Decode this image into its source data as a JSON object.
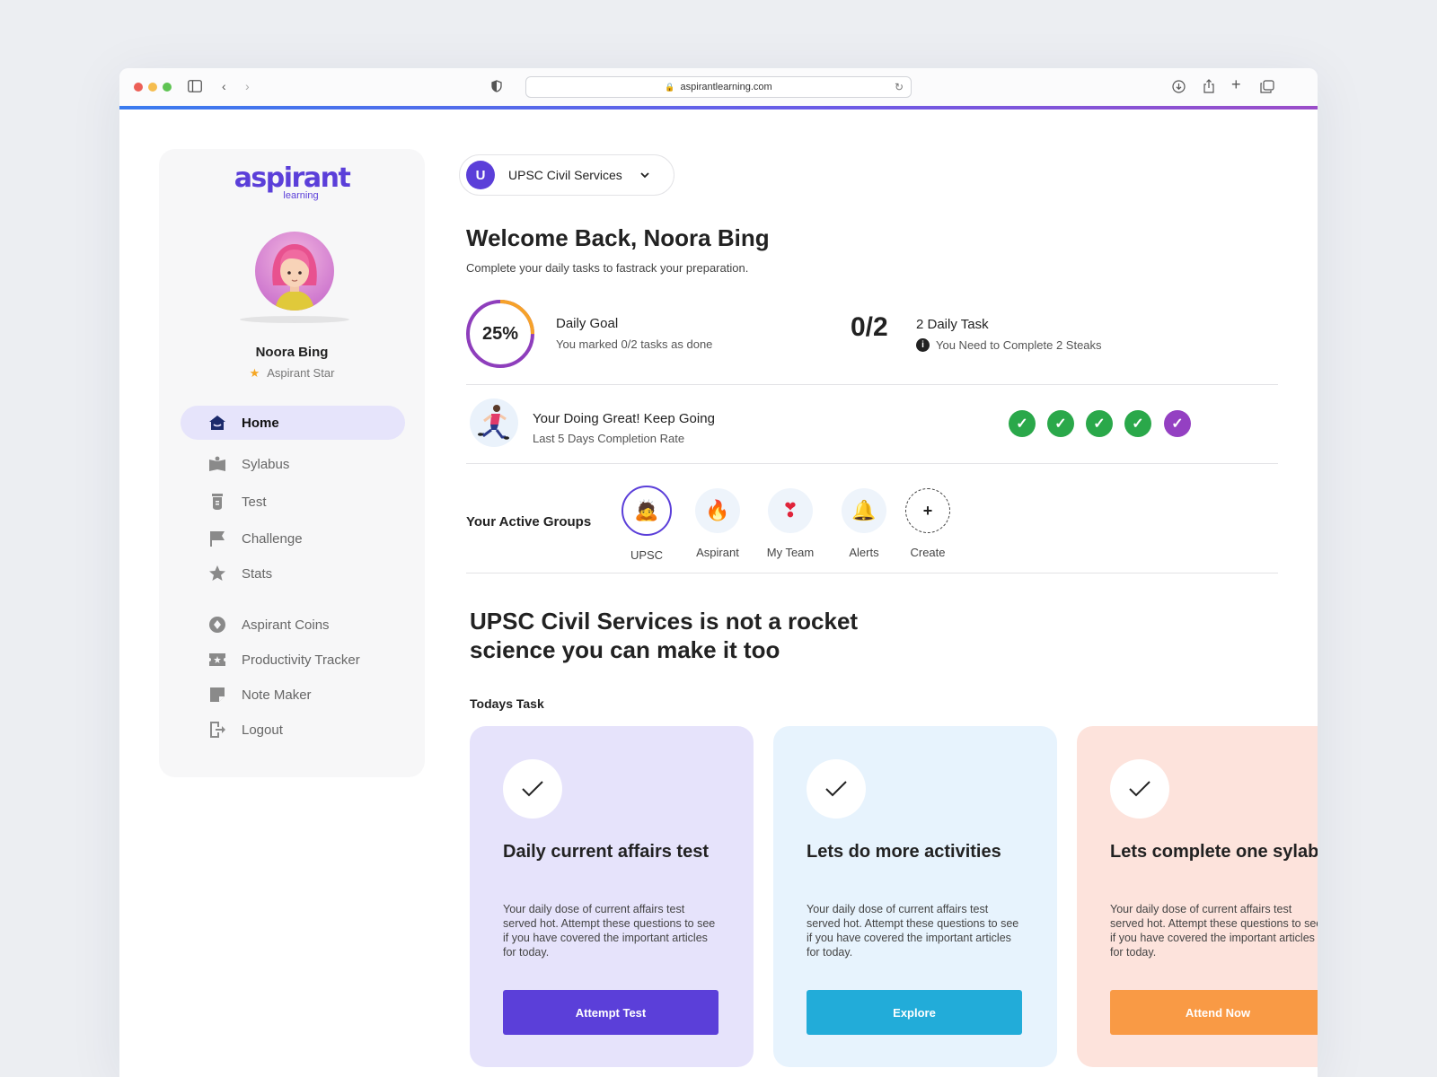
{
  "browser": {
    "url": "aspirantlearning.com",
    "traffic_lights": [
      "#ec5f56",
      "#f5bd4f",
      "#5fc453"
    ]
  },
  "brand": {
    "name": "aspirant",
    "sub": "learning",
    "color": "#5b3fd9"
  },
  "user": {
    "name": "Noora Bing",
    "role": "Aspirant Star"
  },
  "sidebar": {
    "items": [
      {
        "label": "Home",
        "icon": "home-icon",
        "active": true
      },
      {
        "label": "Sylabus",
        "icon": "book-icon"
      },
      {
        "label": "Test",
        "icon": "test-tube-icon"
      },
      {
        "label": "Challenge",
        "icon": "flag-icon"
      },
      {
        "label": "Stats",
        "icon": "star-icon"
      },
      {
        "label": "Aspirant Coins",
        "icon": "coin-icon"
      },
      {
        "label": "Productivity Tracker",
        "icon": "ticket-icon"
      },
      {
        "label": "Note Maker",
        "icon": "note-icon"
      },
      {
        "label": "Logout",
        "icon": "logout-icon"
      }
    ]
  },
  "course": {
    "initial": "U",
    "label": "UPSC Civil Services"
  },
  "welcome": {
    "title": "Welcome Back, Noora Bing",
    "subtitle": "Complete your daily tasks to fastrack your preparation."
  },
  "daily_goal": {
    "percent_label": "25%",
    "progress": 0.25,
    "title": "Daily Goal",
    "subtitle": "You marked 0/2 tasks as done"
  },
  "daily_task": {
    "count": "0/2",
    "title": "2 Daily Task",
    "subtitle": "You Need to Complete 2 Steaks"
  },
  "streak": {
    "title": "Your Doing Great! Keep Going",
    "subtitle": "Last 5 Days Completion Rate",
    "days": [
      "done",
      "done",
      "done",
      "done",
      "current"
    ],
    "colors": {
      "done": "#2aa84a",
      "current": "#9440c2"
    }
  },
  "groups": {
    "label": "Your Active Groups",
    "items": [
      {
        "label": "UPSC",
        "emoji": "🙇",
        "selected": true
      },
      {
        "label": "Aspirant",
        "emoji": "🔥"
      },
      {
        "label": "My Team",
        "emoji": "❣"
      },
      {
        "label": "Alerts",
        "emoji": "🔔"
      },
      {
        "label": "Create",
        "emoji": "+"
      }
    ]
  },
  "motto": "UPSC Civil Services is not a rocket science you can make it too",
  "todays_task": {
    "label": "Todays Task",
    "cards": [
      {
        "title": "Daily current affairs test",
        "description": "Your daily dose of current affairs test served hot. Attempt these questions to see if you have covered the important articles for today.",
        "button": "Attempt Test",
        "bg": "#e6e3fb",
        "button_color": "#5b3fd9"
      },
      {
        "title": "Lets do more activities",
        "description": "Your daily dose of current affairs test served hot. Attempt these questions to see if you have covered the important articles for today.",
        "button": "Explore",
        "bg": "#e7f3fd",
        "button_color": "#22acd9"
      },
      {
        "title": "Lets complete one sylabus",
        "description": "Your daily dose of current affairs test served hot. Attempt these questions to see if you have covered the important articles for today.",
        "button": "Attend Now",
        "bg": "#fde3dc",
        "button_color": "#f99a45"
      }
    ]
  }
}
